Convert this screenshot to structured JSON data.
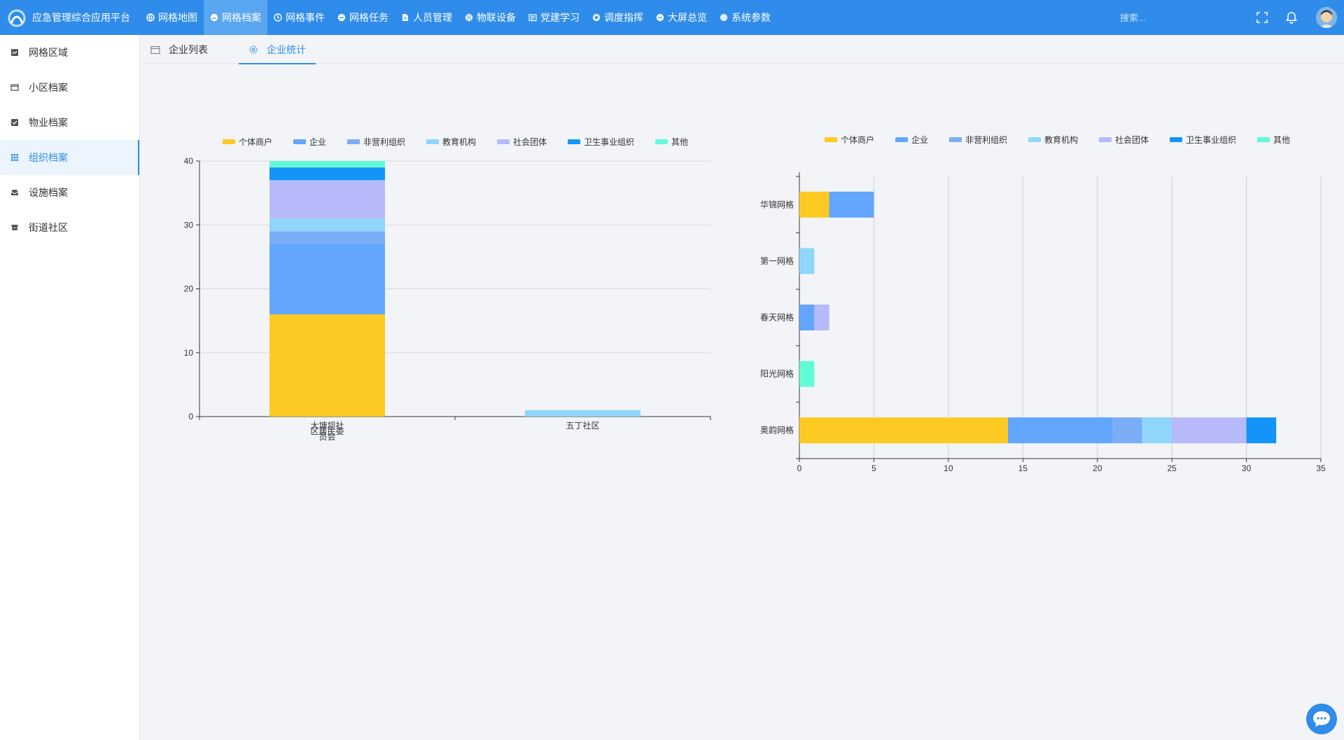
{
  "app": {
    "title": "应急管理综合应用平台"
  },
  "nav": [
    {
      "label": "网格地图",
      "icon": "globe-icon",
      "active": false
    },
    {
      "label": "网格档案",
      "icon": "folder-cloud-icon",
      "active": true
    },
    {
      "label": "网格事件",
      "icon": "clock-icon",
      "active": false
    },
    {
      "label": "网格任务",
      "icon": "task-icon",
      "active": false
    },
    {
      "label": "人员管理",
      "icon": "document-icon",
      "active": false
    },
    {
      "label": "物联设备",
      "icon": "baseball-icon",
      "active": false
    },
    {
      "label": "党建学习",
      "icon": "book-icon",
      "active": false
    },
    {
      "label": "调度指挥",
      "icon": "compass-icon",
      "active": false
    },
    {
      "label": "大屏总览",
      "icon": "minus-circle-icon",
      "active": false
    },
    {
      "label": "系统参数",
      "icon": "dot-circle-icon",
      "active": false
    }
  ],
  "search": {
    "placeholder": "搜索..."
  },
  "sidebar": {
    "items": [
      {
        "label": "网格区域",
        "icon": "chart-box-icon",
        "active": false
      },
      {
        "label": "小区档案",
        "icon": "window-icon",
        "active": false
      },
      {
        "label": "物业档案",
        "icon": "check-box-icon",
        "active": false
      },
      {
        "label": "组织档案",
        "icon": "grid-dots-icon",
        "active": true
      },
      {
        "label": "设施档案",
        "icon": "inbox-icon",
        "active": false
      },
      {
        "label": "街道社区",
        "icon": "archive-icon",
        "active": false
      }
    ]
  },
  "tabs": [
    {
      "label": "企业列表",
      "icon": "calendar-icon",
      "active": false
    },
    {
      "label": "企业统计",
      "icon": "gear-icon",
      "active": true
    }
  ],
  "colors": {
    "accent": "#2f8cea",
    "series": [
      "#fdca23",
      "#62a6fd",
      "#7aadf6",
      "#90d6fb",
      "#b6bafa",
      "#1395f7",
      "#62fbd8"
    ]
  },
  "chart_data": [
    {
      "type": "bar",
      "stacked": true,
      "orientation": "vertical",
      "categories": [
        "大塘坝社区居民委员会",
        "五丁社区"
      ],
      "series": [
        {
          "name": "个体商户",
          "values": [
            16,
            0
          ]
        },
        {
          "name": "企业",
          "values": [
            11,
            0
          ]
        },
        {
          "name": "非营利组织",
          "values": [
            2,
            0
          ]
        },
        {
          "name": "教育机构",
          "values": [
            2,
            1
          ]
        },
        {
          "name": "社会团体",
          "values": [
            6,
            0
          ]
        },
        {
          "name": "卫生事业组织",
          "values": [
            2,
            0
          ]
        },
        {
          "name": "其他",
          "values": [
            1,
            0
          ]
        }
      ],
      "ylim": [
        0,
        40
      ],
      "yticks": [
        0,
        10,
        20,
        30,
        40
      ],
      "grid": true,
      "legend": "top"
    },
    {
      "type": "bar",
      "stacked": true,
      "orientation": "horizontal",
      "categories": [
        "华锦网格",
        "第一网格",
        "春天网格",
        "阳光网格",
        "奥韵网格"
      ],
      "series": [
        {
          "name": "个体商户",
          "values": [
            2,
            0,
            0,
            0,
            14
          ]
        },
        {
          "name": "企业",
          "values": [
            3,
            0,
            1,
            0,
            7
          ]
        },
        {
          "name": "非营利组织",
          "values": [
            0,
            0,
            0,
            0,
            2
          ]
        },
        {
          "name": "教育机构",
          "values": [
            0,
            1,
            0,
            0,
            2
          ]
        },
        {
          "name": "社会团体",
          "values": [
            0,
            0,
            1,
            0,
            5
          ]
        },
        {
          "name": "卫生事业组织",
          "values": [
            0,
            0,
            0,
            0,
            2
          ]
        },
        {
          "name": "其他",
          "values": [
            0,
            0,
            0,
            1,
            0
          ]
        }
      ],
      "xlim": [
        0,
        35
      ],
      "xticks": [
        0,
        5,
        10,
        15,
        20,
        25,
        30,
        35
      ],
      "grid": true,
      "legend": "top"
    }
  ]
}
